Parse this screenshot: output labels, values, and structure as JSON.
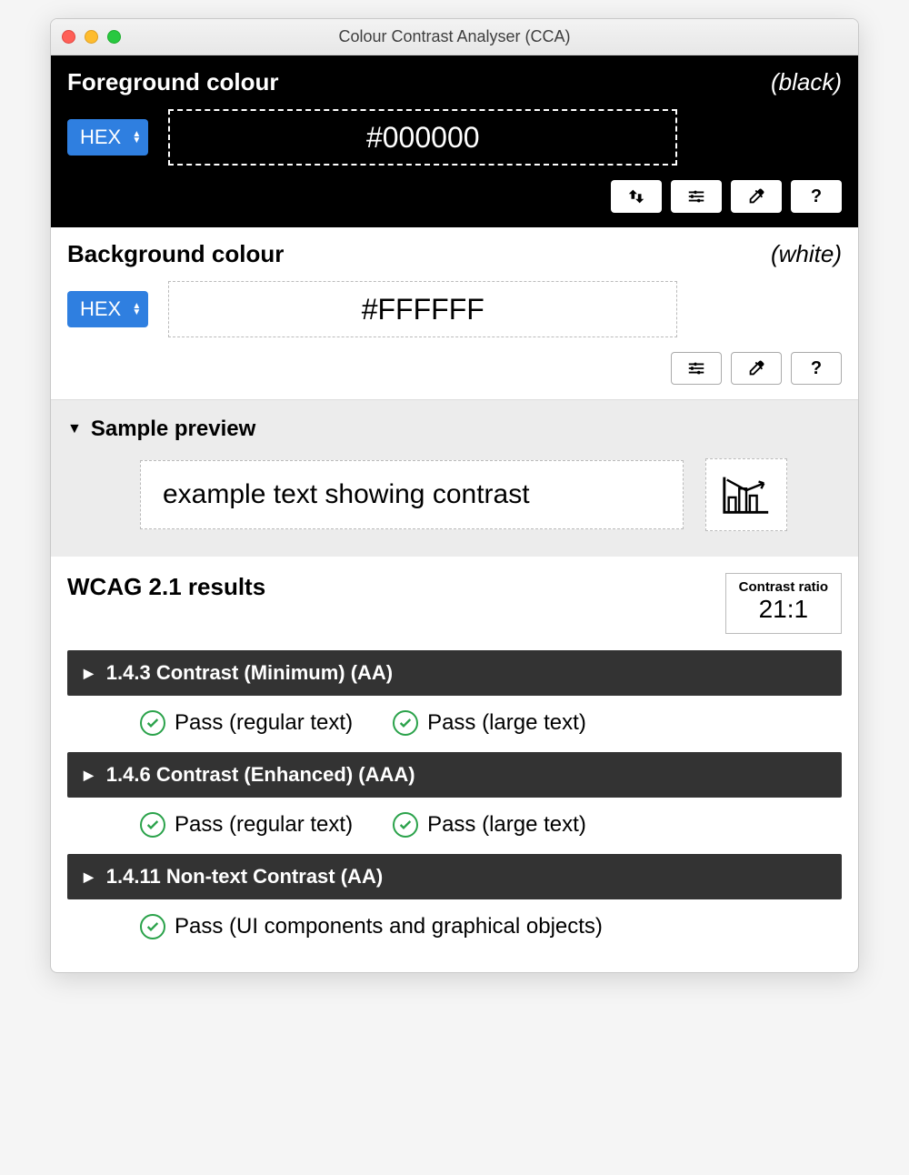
{
  "window": {
    "title": "Colour Contrast Analyser (CCA)"
  },
  "foreground": {
    "label": "Foreground colour",
    "name": "(black)",
    "format": "HEX",
    "value": "#000000"
  },
  "background": {
    "label": "Background colour",
    "name": "(white)",
    "format": "HEX",
    "value": "#FFFFFF"
  },
  "sample": {
    "heading": "Sample preview",
    "text": "example text showing contrast"
  },
  "results": {
    "heading": "WCAG 2.1 results",
    "ratio_label": "Contrast ratio",
    "ratio": "21:1",
    "criteria": [
      {
        "title": "1.4.3 Contrast (Minimum) (AA)",
        "passes": [
          "Pass (regular text)",
          "Pass (large text)"
        ]
      },
      {
        "title": "1.4.6 Contrast (Enhanced) (AAA)",
        "passes": [
          "Pass (regular text)",
          "Pass (large text)"
        ]
      },
      {
        "title": "1.4.11 Non-text Contrast (AA)",
        "passes": [
          "Pass (UI components and graphical objects)"
        ]
      }
    ]
  }
}
